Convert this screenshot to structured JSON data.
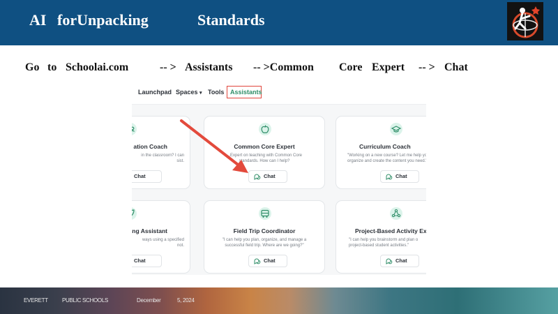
{
  "slide": {
    "title_words": [
      "AI",
      "forUnpacking",
      "Standards"
    ],
    "instruction_words": [
      "Go",
      "to",
      "Schoolai.com",
      "-- >",
      "Assistants",
      "-- >Common",
      "Core",
      "Expert",
      "-- >",
      "Chat"
    ]
  },
  "app": {
    "nav": [
      "Launchpad",
      "Spaces",
      "Tools",
      "Assistants"
    ],
    "spaces_caret": "▾",
    "active_tab": "Assistants",
    "cards": [
      {
        "title": "ation Coach",
        "desc": "in the classroom? I can\nsist.",
        "chat_label": "Chat",
        "icon": "users-icon"
      },
      {
        "title": "Common Core Expert",
        "desc": "...Expert on teaching with Common Core\nstandards. How can I help?",
        "chat_label": "Chat",
        "icon": "apple-icon"
      },
      {
        "title": "Curriculum Coach",
        "desc": "\"Working on a new course? Let me help you\norganize and create the content you need.\"",
        "chat_label": "Chat",
        "icon": "graduation-cap-icon"
      },
      {
        "title": "ing Assistant",
        "desc": "ways using a specified\nnot.",
        "chat_label": "Chat",
        "icon": "leaf-icon"
      },
      {
        "title": "Field Trip Coordinator",
        "desc": "\"I can help you plan, organize, and manage a\nsuccessful field trip. Where are we going?\"",
        "chat_label": "Chat",
        "icon": "bus-icon"
      },
      {
        "title": "Project-Based Activity Exp",
        "desc": "\"I can help you brainstorm and plan o\nproject-based student activities.\"",
        "chat_label": "Chat",
        "icon": "project-icon"
      }
    ]
  },
  "footer": {
    "words": [
      "EVERETT",
      "PUBLIC SCHOOLS",
      "December",
      "5, 2024"
    ]
  },
  "colors": {
    "title_bar": "#0f5082",
    "accent_green": "#2f8e68",
    "highlight_red": "#e0453b",
    "arrow_red": "#e34a3c"
  }
}
